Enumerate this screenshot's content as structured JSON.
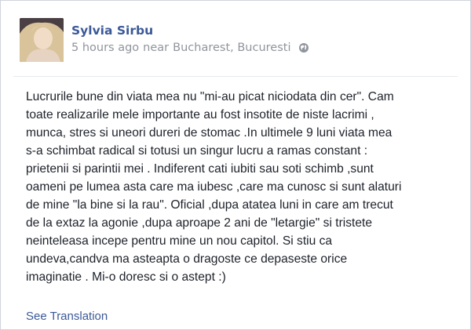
{
  "post": {
    "author": "Sylvia Sirbu",
    "timestamp": "5 hours ago",
    "near": "near",
    "location": "Bucharest, Bucuresti",
    "privacy_icon": "globe-icon",
    "text": "Lucrurile bune din viata mea nu \"mi-au picat niciodata din cer\". Cam\ntoate realizarile mele importante au fost insotite de niste lacrimi ,\n munca, stres si uneori dureri de stomac .In ultimele 9 luni viata mea\ns-a schimbat radical si totusi un singur lucru a ramas constant :\nprietenii si parintii mei . Indiferent cati iubiti sau soti schimb ,sunt\noameni pe lumea asta care ma iubesc ,care ma cunosc si sunt alaturi\nde mine \"la bine si la rau\". Oficial ,dupa atatea luni in care am trecut\nde la extaz la agonie ,dupa aproape 2 ani de \"letargie\" si tristete\nneinteleasa incepe pentru mine un nou capitol. Si stiu ca\nundeva,candva ma asteapta o dragoste ce depaseste orice\nimaginatie . Mi-o doresc si o astept :)",
    "see_translation": "See Translation"
  },
  "colors": {
    "link_blue": "#3b5998",
    "meta_gray": "#90949c",
    "text": "#1d2129"
  }
}
